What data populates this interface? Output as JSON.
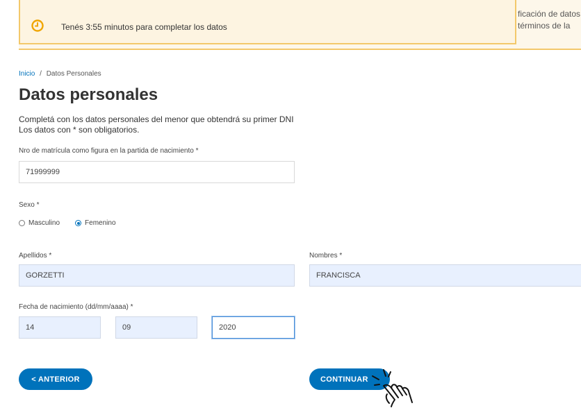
{
  "banner": {
    "timer_text": "Tenés 3:55 minutos para completar los datos",
    "behind_line1": "ficación de datos",
    "behind_line2": "términos de la"
  },
  "breadcrumb": {
    "home": "Inicio",
    "separator": "/",
    "current": "Datos Personales"
  },
  "page": {
    "title": "Datos personales",
    "description_line1": "Completá con los datos personales del menor que obtendrá su primer DNI",
    "description_line2": "Los datos con * son obligatorios."
  },
  "form": {
    "matricula_label": "Nro de matrícula como figura en la partida de nacimiento *",
    "matricula_value": "71999999",
    "sexo_label": "Sexo *",
    "sexo_options": [
      "Masculino",
      "Femenino"
    ],
    "sexo_selected": "Femenino",
    "apellidos_label": "Apellidos *",
    "apellidos_value": "GORZETTI",
    "nombres_label": "Nombres *",
    "nombres_value": "FRANCISCA",
    "fecha_label": "Fecha de nacimiento (dd/mm/aaaa) *",
    "fecha_day": "14",
    "fecha_month": "09",
    "fecha_year": "2020"
  },
  "buttons": {
    "prev": "< ANTERIOR",
    "next": "CONTINUAR"
  },
  "colors": {
    "primary": "#0072bb",
    "warning_border": "#f3c86a",
    "warning_bg": "#fdf4e1",
    "clock": "#f0a500"
  },
  "icons": {
    "timer": "clock-icon",
    "cursor": "hand-pointer-icon"
  }
}
